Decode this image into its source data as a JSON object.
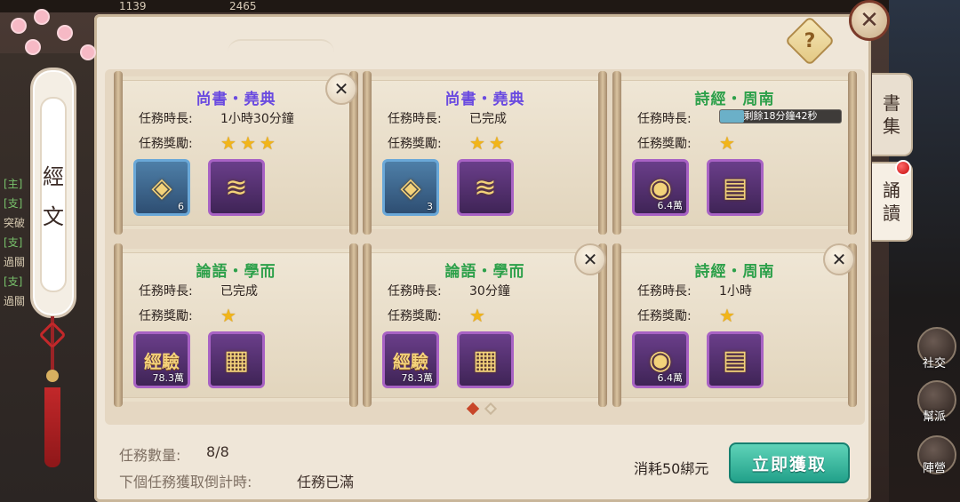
{
  "topbar": {
    "stat_left": "1139",
    "stat_right": "2465"
  },
  "chat_lines": [
    {
      "tag": "[主]",
      "text": ""
    },
    {
      "tag": "[支]",
      "text": ""
    },
    {
      "tag": "",
      "text": "突破"
    },
    {
      "tag": "[支]",
      "text": ""
    },
    {
      "tag": "",
      "text": "過關"
    },
    {
      "tag": "[支]",
      "text": ""
    },
    {
      "tag": "",
      "text": "過關"
    }
  ],
  "banner": {
    "chars": [
      "經",
      "文"
    ]
  },
  "tabs": [
    {
      "label": "書集",
      "chars": [
        "書",
        "集"
      ],
      "active": false,
      "has_dot": false
    },
    {
      "label": "誦讀",
      "chars": [
        "誦",
        "讀"
      ],
      "active": true,
      "has_dot": true
    }
  ],
  "help_label": "?",
  "close_main_label": "✕",
  "cards": [
    {
      "title": "尚書・堯典",
      "title_color": "#6a4ae0",
      "duration_label": "任務時長:",
      "duration": "1小時30分鐘",
      "reward_label": "任務獎勵:",
      "stars": 3,
      "items": [
        {
          "icon": "treasure-chest-icon",
          "glyph": "◈",
          "count": "6",
          "frame": "blue"
        },
        {
          "icon": "scroll-icon",
          "glyph": "≋",
          "count": "",
          "frame": "purple"
        }
      ],
      "closable": true
    },
    {
      "title": "尚書・堯典",
      "title_color": "#6a4ae0",
      "duration_label": "任務時長:",
      "duration": "已完成",
      "reward_label": "任務獎勵:",
      "stars": 2,
      "items": [
        {
          "icon": "treasure-chest-icon",
          "glyph": "◈",
          "count": "3",
          "frame": "blue"
        },
        {
          "icon": "scroll-icon",
          "glyph": "≋",
          "count": "",
          "frame": "purple"
        }
      ],
      "closable": false
    },
    {
      "title": "詩經・周南",
      "title_color": "#2da04a",
      "duration_label": "任務時長:",
      "duration": "",
      "timer_text": "剩餘18分鐘42秒",
      "timer_progress": 0.2,
      "reward_label": "任務獎勵:",
      "stars": 1,
      "items": [
        {
          "icon": "gold-coin-icon",
          "glyph": "◉",
          "count": "6.4萬",
          "frame": "purple"
        },
        {
          "icon": "book-icon",
          "glyph": "▤",
          "count": "",
          "frame": "purple"
        }
      ],
      "closable": false
    },
    {
      "title": "論語・學而",
      "title_color": "#2da04a",
      "duration_label": "任務時長:",
      "duration": "已完成",
      "reward_label": "任務獎勵:",
      "stars": 1,
      "items": [
        {
          "icon": "exp-icon",
          "exp": "經驗",
          "count": "78.3萬",
          "frame": "purple"
        },
        {
          "icon": "painting-scroll-icon",
          "glyph": "▦",
          "count": "",
          "frame": "purple"
        }
      ],
      "closable": false
    },
    {
      "title": "論語・學而",
      "title_color": "#2da04a",
      "duration_label": "任務時長:",
      "duration": "30分鐘",
      "reward_label": "任務獎勵:",
      "stars": 1,
      "items": [
        {
          "icon": "exp-icon",
          "exp": "經驗",
          "count": "78.3萬",
          "frame": "purple"
        },
        {
          "icon": "painting-scroll-icon",
          "glyph": "▦",
          "count": "",
          "frame": "purple"
        }
      ],
      "closable": true
    },
    {
      "title": "詩經・周南",
      "title_color": "#2da04a",
      "duration_label": "任務時長:",
      "duration": "1小時",
      "reward_label": "任務獎勵:",
      "stars": 1,
      "items": [
        {
          "icon": "gold-coin-icon",
          "glyph": "◉",
          "count": "6.4萬",
          "frame": "purple"
        },
        {
          "icon": "book-icon",
          "glyph": "▤",
          "count": "",
          "frame": "purple"
        }
      ],
      "closable": true
    }
  ],
  "pager": {
    "pages": 2,
    "current": 1
  },
  "footer": {
    "task_count_label": "任務數量:",
    "task_count": "8/8",
    "countdown_label": "下個任務獲取倒計時:",
    "countdown_value": "任務已滿",
    "cost": "消耗50綁元",
    "get_button": "立即獲取"
  },
  "side_buttons": [
    {
      "label": "社交"
    },
    {
      "label": "幫派"
    },
    {
      "label": "陣營"
    }
  ],
  "colors": {
    "accent_green": "#22a18a",
    "star": "#f1b51a",
    "frame_purple": "#a862c4",
    "frame_blue": "#6aa8d8"
  }
}
